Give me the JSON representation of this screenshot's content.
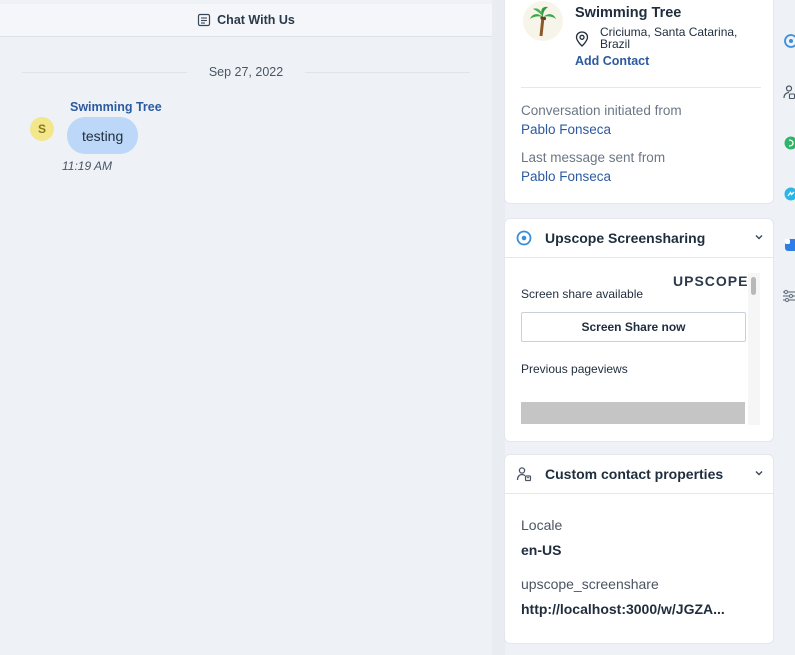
{
  "chat": {
    "header_title": "Chat With Us",
    "date_separator": "Sep 27, 2022",
    "message": {
      "avatar_initial": "S",
      "sender": "Swimming Tree",
      "text": "testing",
      "time": "11:19 AM"
    }
  },
  "contact_card": {
    "name": "Swimming Tree",
    "location": "Criciuma, Santa Catarina, Brazil",
    "add_contact": "Add Contact",
    "initiated_label": "Conversation initiated from",
    "initiated_value": "Pablo Fonseca",
    "last_message_label": "Last message sent from",
    "last_message_value": "Pablo Fonseca"
  },
  "upscope_card": {
    "title": "Upscope Screensharing",
    "logo_text": "UPSCOPE",
    "screen_share_status": "Screen share available",
    "screen_share_button": "Screen Share now",
    "previous_pageviews": "Previous pageviews"
  },
  "custom_props_card": {
    "title": "Custom contact properties",
    "properties": [
      {
        "label": "Locale",
        "value": "en-US"
      },
      {
        "label": "upscope_screenshare",
        "value": "http://localhost:3000/w/JGZA..."
      }
    ]
  },
  "colors": {
    "accent_blue": "#2c5aa0",
    "bubble_blue": "#bcd7f7",
    "avatar_yellow": "#f3e68b",
    "upscope_icon": "#3b8fd9"
  },
  "rail_icons": [
    "upscope-icon",
    "contact-properties-icon",
    "green-app-icon",
    "messenger-icon",
    "blue-app-icon",
    "settings-sliders-icon"
  ]
}
